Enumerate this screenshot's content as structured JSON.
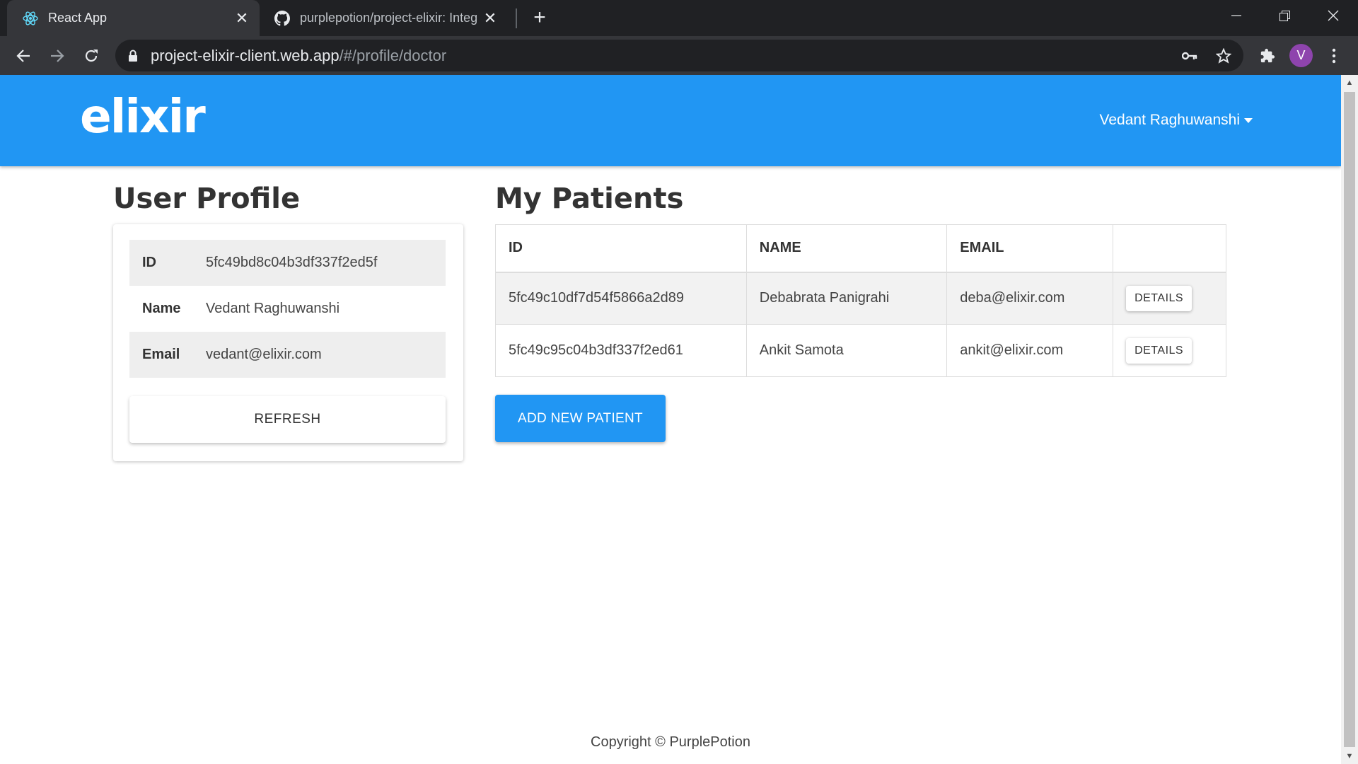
{
  "browser": {
    "tabs": [
      {
        "title": "React App",
        "icon": "react-icon",
        "active": true
      },
      {
        "title": "purplepotion/project-elixir: Integ",
        "icon": "github-icon",
        "active": false
      }
    ],
    "url_host": "project-elixir-client.web.app",
    "url_path": "/#/profile/doctor",
    "profile_initial": "V"
  },
  "header": {
    "brand": "elixir",
    "user_name": "Vedant Raghuwanshi"
  },
  "profile": {
    "title": "User Profile",
    "rows": [
      {
        "label": "ID",
        "value": "5fc49bd8c04b3df337f2ed5f"
      },
      {
        "label": "Name",
        "value": "Vedant Raghuwanshi"
      },
      {
        "label": "Email",
        "value": "vedant@elixir.com"
      }
    ],
    "refresh_label": "REFRESH"
  },
  "patients": {
    "title": "My Patients",
    "columns": [
      "ID",
      "NAME",
      "EMAIL",
      ""
    ],
    "rows": [
      {
        "id": "5fc49c10df7d54f5866a2d89",
        "name": "Debabrata Panigrahi",
        "email": "deba@elixir.com",
        "action": "DETAILS"
      },
      {
        "id": "5fc49c95c04b3df337f2ed61",
        "name": "Ankit Samota",
        "email": "ankit@elixir.com",
        "action": "DETAILS"
      }
    ],
    "add_label": "ADD NEW PATIENT"
  },
  "footer": {
    "text": "Copyright © PurplePotion"
  },
  "colors": {
    "brand_blue": "#2196f3",
    "chrome_dark": "#202124",
    "chrome_toolbar": "#35363a"
  }
}
